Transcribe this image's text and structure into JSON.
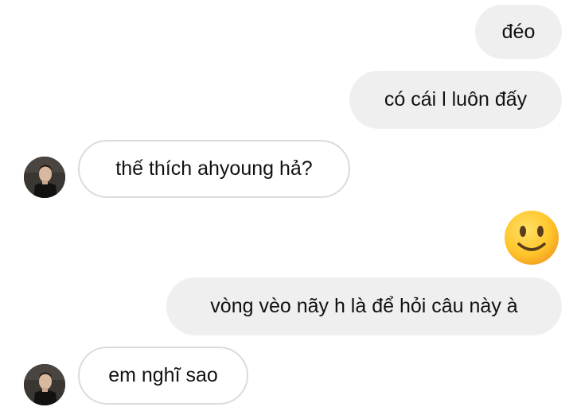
{
  "conversation": {
    "messages": [
      {
        "sender": "me",
        "type": "text",
        "text": "đéo"
      },
      {
        "sender": "me",
        "type": "text",
        "text": "có cái l luôn đấy"
      },
      {
        "sender": "other",
        "type": "text",
        "text": "thế thích ahyoung hả?"
      },
      {
        "sender": "me",
        "type": "emoji",
        "emoji": "slightly-smiling-face-icon"
      },
      {
        "sender": "me",
        "type": "text",
        "text": "vòng vèo nãy h là để hỏi câu này à"
      },
      {
        "sender": "other",
        "type": "text",
        "text": "em nghĩ sao"
      }
    ]
  },
  "colors": {
    "sent_bubble": "#efefef",
    "received_border": "#dbdbdb",
    "text": "#111111",
    "emoji_face": "#ffc62b"
  }
}
